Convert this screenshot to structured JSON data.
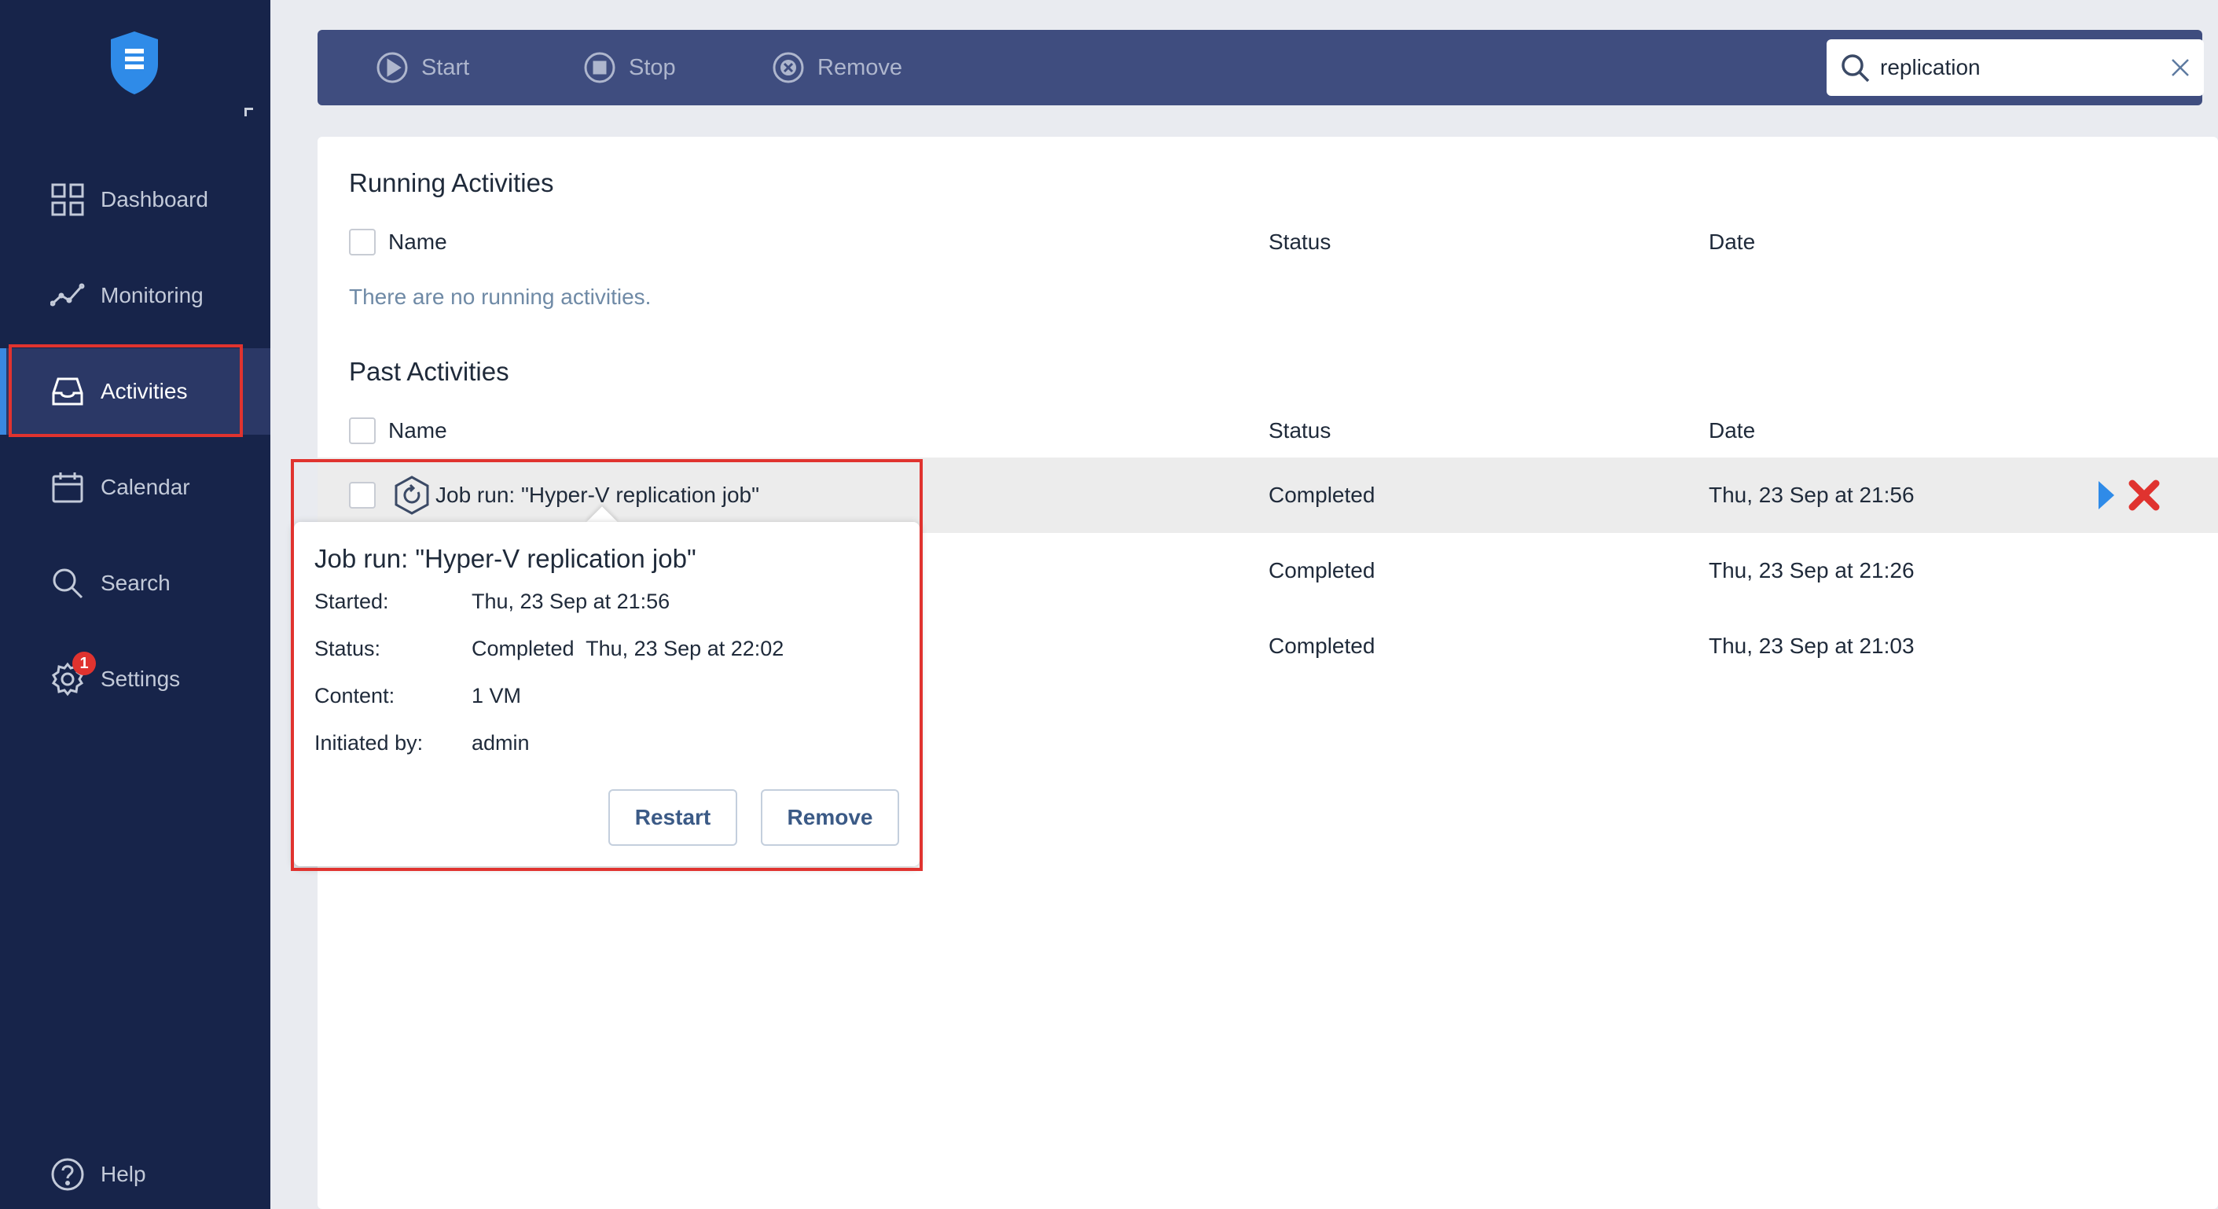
{
  "sidebar": {
    "items": [
      {
        "label": "Dashboard",
        "icon": "grid-icon"
      },
      {
        "label": "Monitoring",
        "icon": "chart-line-icon"
      },
      {
        "label": "Activities",
        "icon": "inbox-icon"
      },
      {
        "label": "Calendar",
        "icon": "calendar-icon"
      },
      {
        "label": "Search",
        "icon": "search-icon"
      },
      {
        "label": "Settings",
        "icon": "gear-icon",
        "badge": "1"
      },
      {
        "label": "Help",
        "icon": "help-icon"
      }
    ],
    "active": "Activities"
  },
  "toolbar": {
    "start_label": "Start",
    "stop_label": "Stop",
    "remove_label": "Remove"
  },
  "search": {
    "value": "replication"
  },
  "running": {
    "title": "Running Activities",
    "col_name": "Name",
    "col_status": "Status",
    "col_date": "Date",
    "empty": "There are no running activities."
  },
  "past": {
    "title": "Past Activities",
    "col_name": "Name",
    "col_status": "Status",
    "col_date": "Date",
    "rows": [
      {
        "name": "Job run: \"Hyper-V replication job\"",
        "status": "Completed",
        "date": "Thu, 23 Sep at 21:56"
      },
      {
        "name": "",
        "status": "Completed",
        "date": "Thu, 23 Sep at 21:26"
      },
      {
        "name": "",
        "status": "Completed",
        "date": "Thu, 23 Sep at 21:03"
      }
    ]
  },
  "popup": {
    "title": "Job run: \"Hyper-V replication job\"",
    "started_label": "Started:",
    "started_value": "Thu, 23 Sep at 21:56",
    "status_label": "Status:",
    "status_value": "Completed",
    "status_date": "Thu, 23 Sep at 22:02",
    "content_label": "Content:",
    "content_value": "1 VM",
    "initiated_label": "Initiated by:",
    "initiated_value": "admin",
    "restart_label": "Restart",
    "remove_label": "Remove"
  },
  "colors": {
    "sidebar_bg": "#17244a",
    "toolbar_bg": "#3f4d7f",
    "accent": "#3a88e0",
    "highlight": "#e0332f"
  }
}
